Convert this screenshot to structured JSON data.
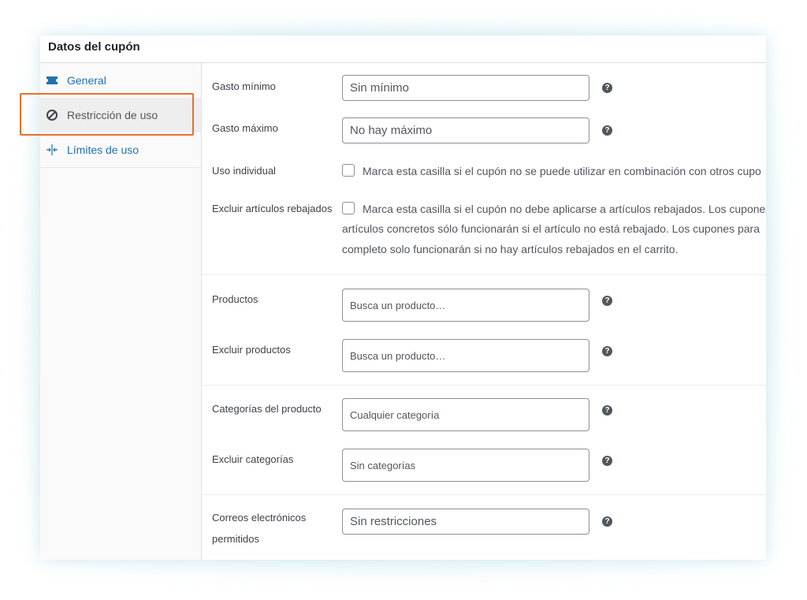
{
  "panel": {
    "title": "Datos del cupón"
  },
  "tabs": [
    {
      "label": "General",
      "icon": "ticket-icon"
    },
    {
      "label": "Restricción de uso",
      "icon": "prohibited-icon"
    },
    {
      "label": "Límites de uso",
      "icon": "arrows-in-icon"
    }
  ],
  "fields": {
    "gasto_minimo": {
      "label": "Gasto mínimo",
      "placeholder": "Sin mínimo"
    },
    "gasto_maximo": {
      "label": "Gasto máximo",
      "placeholder": "No hay máximo"
    },
    "uso_individual": {
      "label": "Uso individual",
      "text": "Marca esta casilla si el cupón no se puede utilizar en combinación con otros cupo"
    },
    "excluir_rebajados": {
      "label": "Excluir artículos rebajados",
      "line1": "Marca esta casilla si el cupón no debe aplicarse a artículos rebajados. Los cupone",
      "line2": "artículos concretos sólo funcionarán si el artículo no está rebajado. Los cupones para",
      "line3": "completo solo funcionarán si no hay artículos rebajados en el carrito."
    },
    "productos": {
      "label": "Productos",
      "placeholder": "Busca un producto…"
    },
    "excluir_productos": {
      "label": "Excluir productos",
      "placeholder": "Busca un producto…"
    },
    "categorias": {
      "label": "Categorías del producto",
      "placeholder": "Cualquier categoría"
    },
    "excluir_categorias": {
      "label": "Excluir categorías",
      "placeholder": "Sin categorías"
    },
    "correos": {
      "label_line1": "Correos electrónicos",
      "label_line2": "permitidos",
      "placeholder": "Sin restricciones"
    }
  },
  "help_glyph": "?",
  "colors": {
    "link": "#2271b1",
    "highlight": "#e8702a",
    "help": "#50575e"
  }
}
